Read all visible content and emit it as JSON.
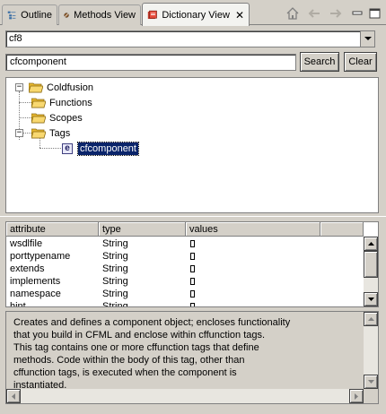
{
  "tabs": [
    {
      "label": "Outline",
      "icon": "outline-icon"
    },
    {
      "label": "Methods View",
      "icon": "methods-icon"
    },
    {
      "label": "Dictionary View",
      "icon": "dictionary-icon",
      "active": true
    }
  ],
  "dictionary_select": {
    "value": "cf8"
  },
  "search": {
    "value": "cfcomponent",
    "search_label": "Search",
    "clear_label": "Clear"
  },
  "tree": {
    "root": "Coldfusion",
    "children": [
      "Functions",
      "Scopes",
      "Tags"
    ],
    "tags_children": [
      "cfcomponent"
    ],
    "selected_marker": "e"
  },
  "attributes_table": {
    "columns": [
      "attribute",
      "type",
      "values"
    ],
    "rows": [
      {
        "attribute": "wsdlfile",
        "type": "String"
      },
      {
        "attribute": "porttypename",
        "type": "String"
      },
      {
        "attribute": "extends",
        "type": "String"
      },
      {
        "attribute": "implements",
        "type": "String"
      },
      {
        "attribute": "namespace",
        "type": "String"
      },
      {
        "attribute": "hint",
        "type": "String"
      }
    ]
  },
  "description": {
    "lines": [
      "Creates and defines a component object; encloses functionality",
      "that you build in CFML and enclose within cffunction tags.",
      "This tag contains one or more cffunction tags that define",
      "methods. Code within the body of this tag, other than",
      "cffunction tags, is executed when the component is",
      "instantiated."
    ]
  },
  "colors": {
    "selection": "#0a246a",
    "folder": "#f4c430"
  }
}
